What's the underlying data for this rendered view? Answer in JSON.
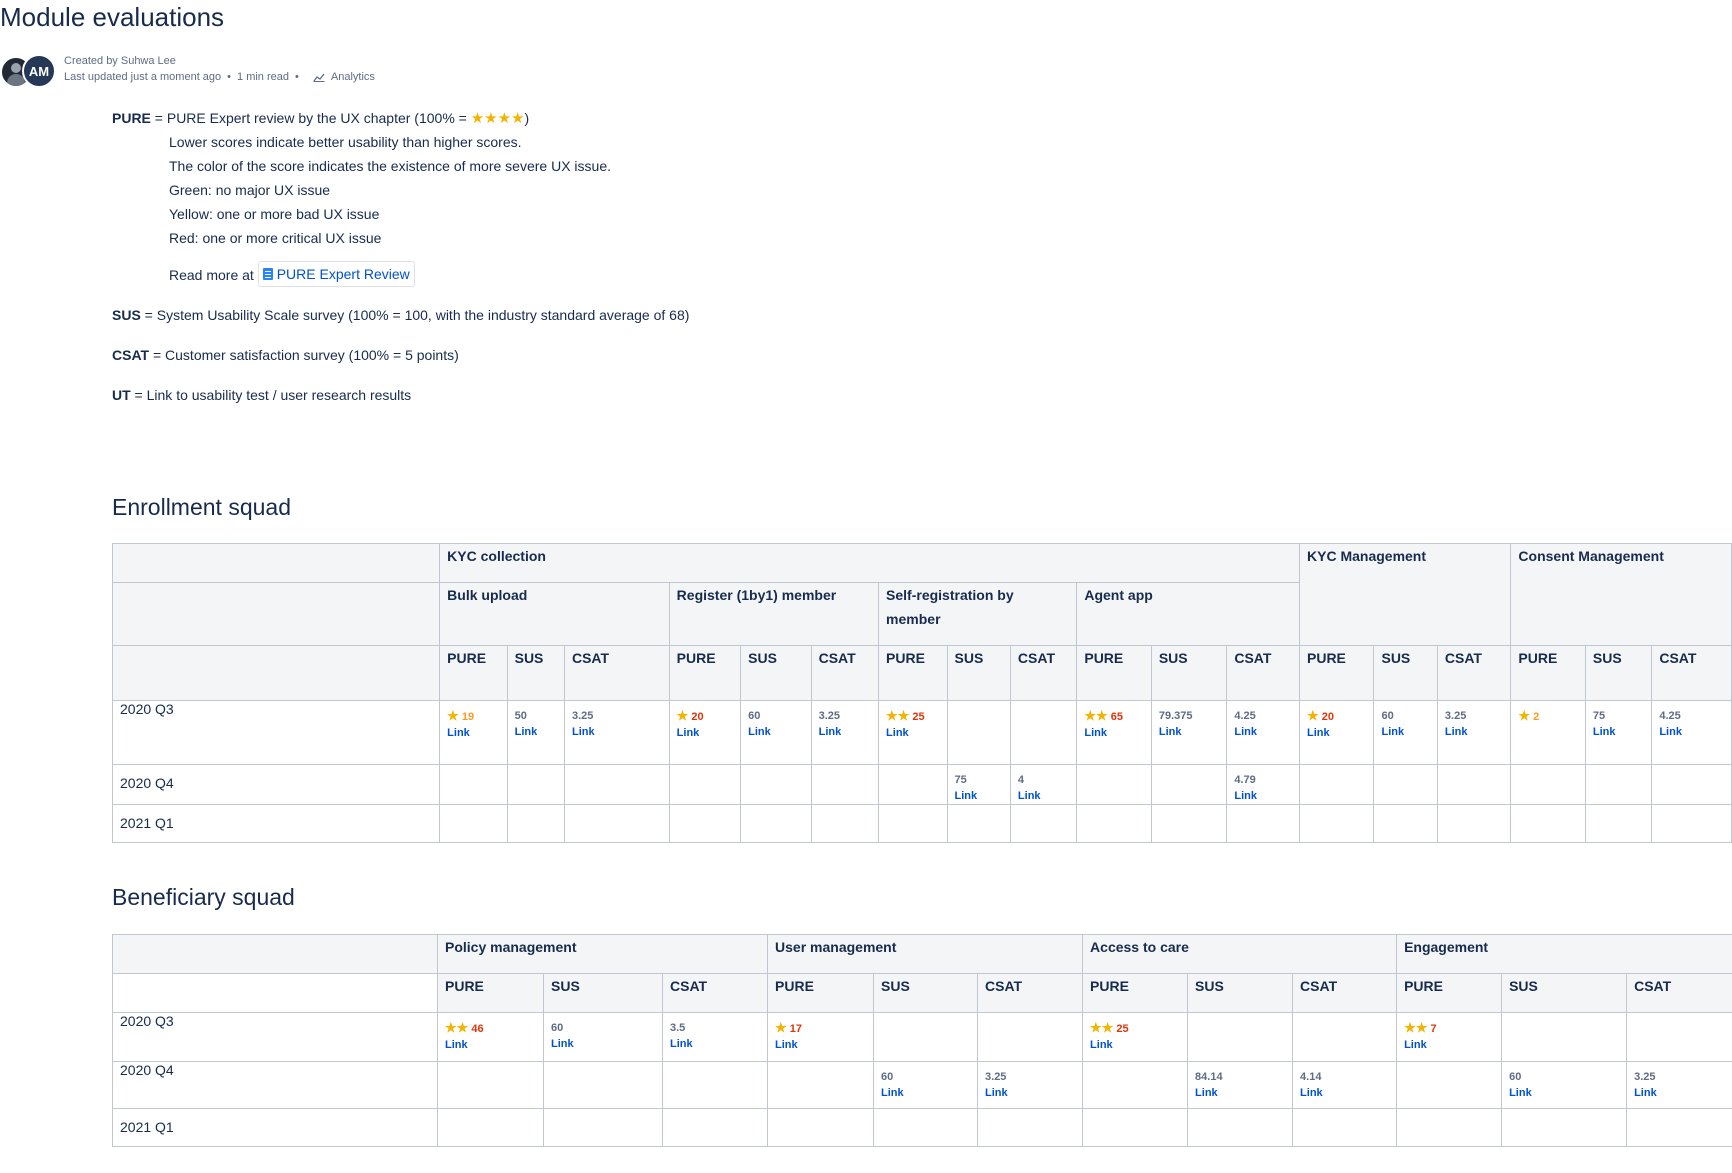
{
  "page": {
    "title": "Module evaluations",
    "created_by": "Created by Suhwa Lee",
    "last_updated": "Last updated just a moment ago",
    "read_time": "1 min read",
    "analytics_label": "Analytics",
    "avatar_initials": "AM"
  },
  "legend": {
    "pure_term": "PURE",
    "pure_def_prefix": " = PURE Expert review by the UX chapter (100% = ",
    "pure_def_suffix": ")",
    "pure_full_stars": "★★★★",
    "line1": "Lower scores indicate better usability than higher scores.",
    "line2": "The color of the score indicates the existence of more severe UX issue.",
    "line3": "Green: no major UX issue",
    "line4": "Yellow: one or more bad UX issue",
    "line5": "Red: one or more critical UX issue",
    "read_more_prefix": "Read more at ",
    "read_more_link": "PURE Expert Review",
    "sus_term": "SUS",
    "sus_def": " = System Usability Scale survey (100% = 100, with the industry standard average of 68)",
    "csat_term": "CSAT",
    "csat_def": " = Customer satisfaction survey (100% = 5 points)",
    "ut_term": "UT",
    "ut_def": " = Link to usability test / user research results"
  },
  "enrollment": {
    "title": "Enrollment squad",
    "group_kyc": "KYC collection",
    "group_kyc_mgmt": "KYC Management",
    "group_consent": "Consent Management",
    "sub_bulk": "Bulk upload",
    "sub_register": "Register (1by1) member",
    "sub_self": "Self-registration by member",
    "sub_agent": "Agent app",
    "col_pure": "PURE",
    "col_sus": "SUS",
    "col_csat": "CSAT",
    "link": "Link",
    "rows": [
      {
        "label": "2020 Q3",
        "cells": [
          {
            "stars": "★",
            "val": "19",
            "tone": "org",
            "link": true
          },
          {
            "val": "50",
            "link": true
          },
          {
            "val": "3.25",
            "link": true
          },
          {
            "stars": "★",
            "val": "20",
            "tone": "red",
            "link": true
          },
          {
            "val": "60",
            "link": true
          },
          {
            "val": "3.25",
            "link": true
          },
          {
            "stars": "★★",
            "val": "25",
            "tone": "red",
            "link": true
          },
          {},
          {},
          {
            "stars": "★★",
            "val": "65",
            "tone": "red",
            "link": true
          },
          {
            "val": "79.375",
            "link": true
          },
          {
            "val": "4.25",
            "link": true
          },
          {
            "stars": "★",
            "val": "20",
            "tone": "red",
            "link": true
          },
          {
            "val": "60",
            "link": true
          },
          {
            "val": "3.25",
            "link": true
          },
          {
            "stars": "★",
            "val": "2",
            "tone": "org",
            "link": false
          },
          {
            "val": "75",
            "link": true
          },
          {
            "val": "4.25",
            "link": true
          }
        ]
      },
      {
        "label": "2020 Q4",
        "cells": [
          {},
          {},
          {},
          {},
          {},
          {},
          {},
          {
            "val": "75",
            "link": true
          },
          {
            "val": "4",
            "link": true
          },
          {},
          {},
          {
            "val": "4.79",
            "link": true
          },
          {},
          {},
          {},
          {},
          {},
          {}
        ]
      },
      {
        "label": "2021 Q1",
        "cells": [
          {},
          {},
          {},
          {},
          {},
          {},
          {},
          {},
          {},
          {},
          {},
          {},
          {},
          {},
          {},
          {},
          {},
          {}
        ]
      }
    ]
  },
  "beneficiary": {
    "title": "Beneficiary squad",
    "group_policy": "Policy management",
    "group_user": "User management",
    "group_access": "Access to care",
    "group_engage": "Engagement",
    "col_pure": "PURE",
    "col_sus": "SUS",
    "col_csat": "CSAT",
    "link": "Link",
    "rows": [
      {
        "label": "2020 Q3",
        "cells": [
          {
            "stars": "★★",
            "val": "46",
            "tone": "red",
            "link": true
          },
          {
            "val": "60",
            "link": true
          },
          {
            "val": "3.5",
            "link": true
          },
          {
            "stars": "★",
            "val": "17",
            "tone": "red",
            "link": true
          },
          {},
          {},
          {
            "stars": "★★",
            "val": "25",
            "tone": "red",
            "link": true
          },
          {},
          {},
          {
            "stars": "★★",
            "val": "7",
            "tone": "red",
            "link": true
          },
          {},
          {}
        ]
      },
      {
        "label": "2020 Q4",
        "cells": [
          {},
          {},
          {},
          {},
          {
            "val": "60",
            "link": true
          },
          {
            "val": "3.25",
            "link": true
          },
          {},
          {
            "val": "84.14",
            "link": true
          },
          {
            "val": "4.14",
            "link": true
          },
          {},
          {
            "val": "60",
            "link": true
          },
          {
            "val": "3.25",
            "link": true
          }
        ]
      },
      {
        "label": "2021 Q1",
        "cells": [
          {},
          {},
          {},
          {},
          {},
          {},
          {},
          {},
          {},
          {},
          {},
          {}
        ]
      }
    ]
  }
}
